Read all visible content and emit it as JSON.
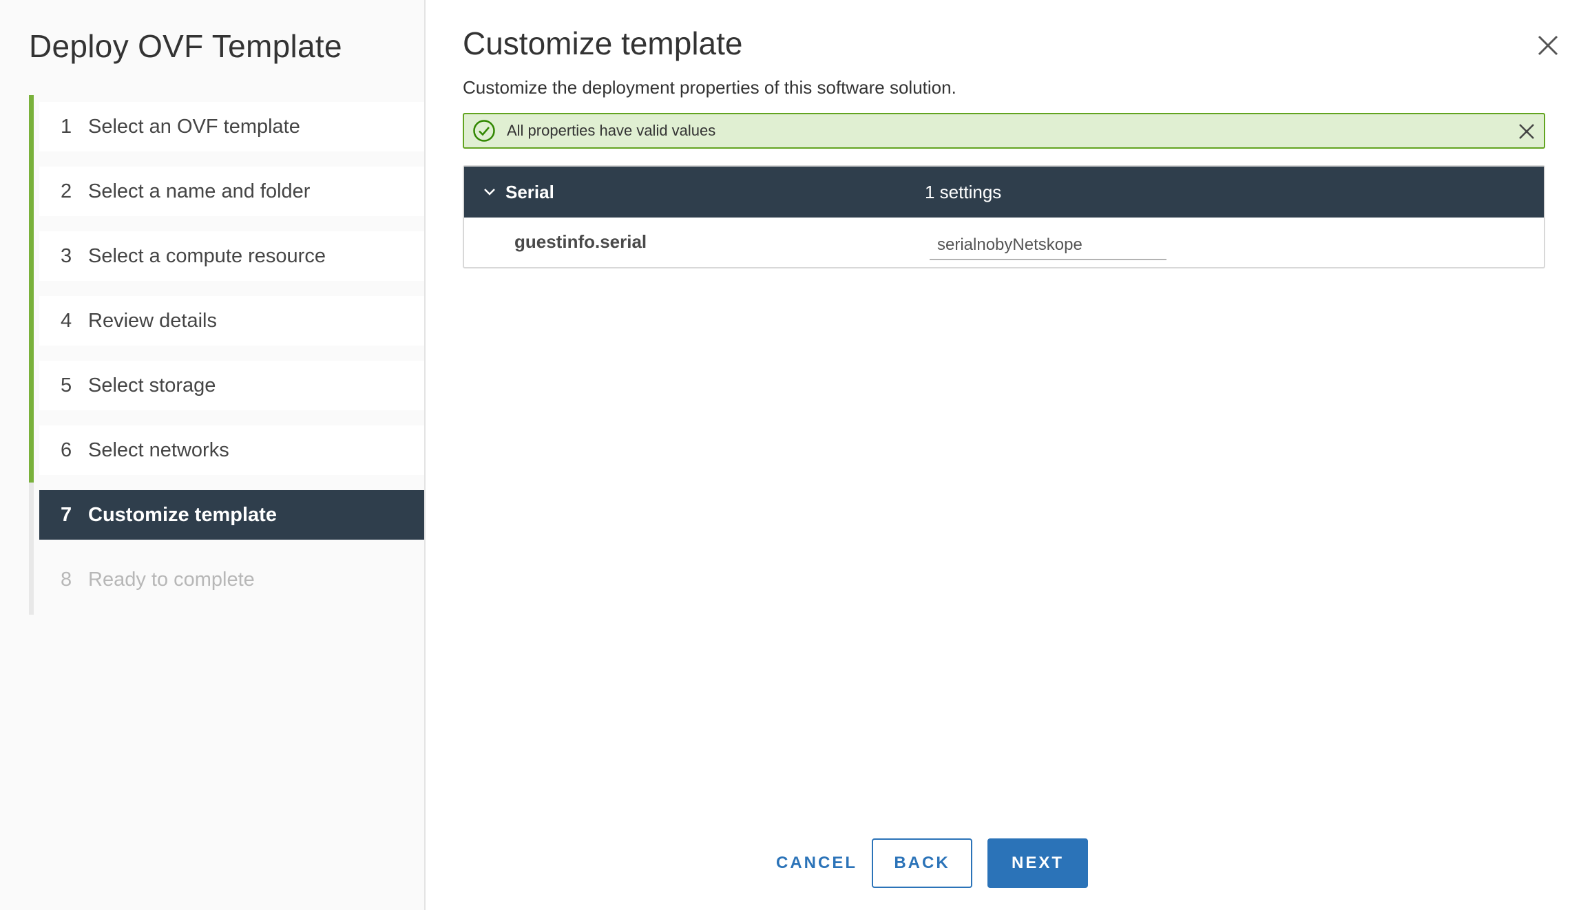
{
  "wizard": {
    "title": "Deploy OVF Template",
    "steps": [
      {
        "number": "1",
        "label": "Select an OVF template",
        "state": "completed"
      },
      {
        "number": "2",
        "label": "Select a name and folder",
        "state": "completed"
      },
      {
        "number": "3",
        "label": "Select a compute resource",
        "state": "completed"
      },
      {
        "number": "4",
        "label": "Review details",
        "state": "completed"
      },
      {
        "number": "5",
        "label": "Select storage",
        "state": "completed"
      },
      {
        "number": "6",
        "label": "Select networks",
        "state": "completed"
      },
      {
        "number": "7",
        "label": "Customize template",
        "state": "active"
      },
      {
        "number": "8",
        "label": "Ready to complete",
        "state": "disabled"
      }
    ]
  },
  "main": {
    "title": "Customize template",
    "subtitle": "Customize the deployment properties of this software solution.",
    "alert": {
      "text": "All properties have valid values",
      "icon": "check-circle-icon"
    },
    "grid": {
      "group": {
        "name": "Serial",
        "count_label": "1 settings",
        "expanded": true
      },
      "rows": [
        {
          "name": "guestinfo.serial",
          "value": "serialnobyNetskope"
        }
      ]
    }
  },
  "footer": {
    "cancel_label": "CANCEL",
    "back_label": "BACK",
    "next_label": "NEXT"
  },
  "colors": {
    "completed_track": "#79b13b",
    "active_step_bg": "#2f3e4c",
    "alert_bg": "#e0efd2",
    "alert_border": "#62a420",
    "primary": "#2b73b8"
  }
}
